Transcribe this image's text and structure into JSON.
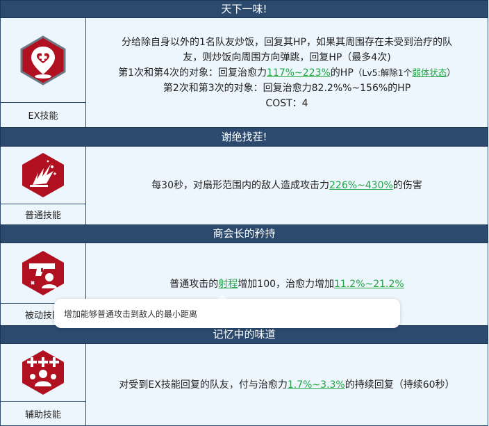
{
  "skills": [
    {
      "title": "天下一味!",
      "type_label": "EX技能",
      "icon": "heart-cross-location-icon",
      "lines": [
        "分给除自身以外的1名队友炒饭，回复其HP，如果其周围存在未受到治疗的队",
        "友，则炒饭向周围方向弹跳，回复HP（最多4次)"
      ],
      "line3_prefix": "第1次和第4次的对象：回复治愈力",
      "line3_value": "117%~223%",
      "line3_mid": "的HP",
      "line3_note_prefix": "（Lv5:解除1个",
      "line3_note_link": "弱体状态",
      "line3_note_suffix": "）",
      "line4": "第2次和第3次的对象：回复治愈力82.2%%~156%的HP",
      "cost": "COST：4"
    },
    {
      "title": "谢绝找茬!",
      "type_label": "普通技能",
      "icon": "explosion-icon",
      "text_prefix": "每30秒，对扇形范围内的敌人造成攻击力",
      "value": "226%~430%",
      "text_suffix": "的伤害"
    },
    {
      "title": "商会长的矜持",
      "type_label": "被动技能",
      "icon": "gun-person-icon",
      "text_prefix": "普通攻击的",
      "link": "射程",
      "text_mid": "增加100，治愈力增加",
      "value": "11.2%~21.2%"
    },
    {
      "title": "记忆中的味道",
      "type_label": "辅助技能",
      "icon": "plus-people-icon",
      "text_prefix": "对受到EX技能回复的队友，付与治愈力",
      "value": "1.7%~3.3%",
      "text_suffix": "的持续回复（持续60秒）"
    }
  ],
  "tooltip": "增加能够普通攻击到敌人的最小距离",
  "colors": {
    "header": "#2b4a6e",
    "row_bg": "#eef6fd",
    "highlight": "#1da541",
    "icon_red": "#b01020"
  }
}
